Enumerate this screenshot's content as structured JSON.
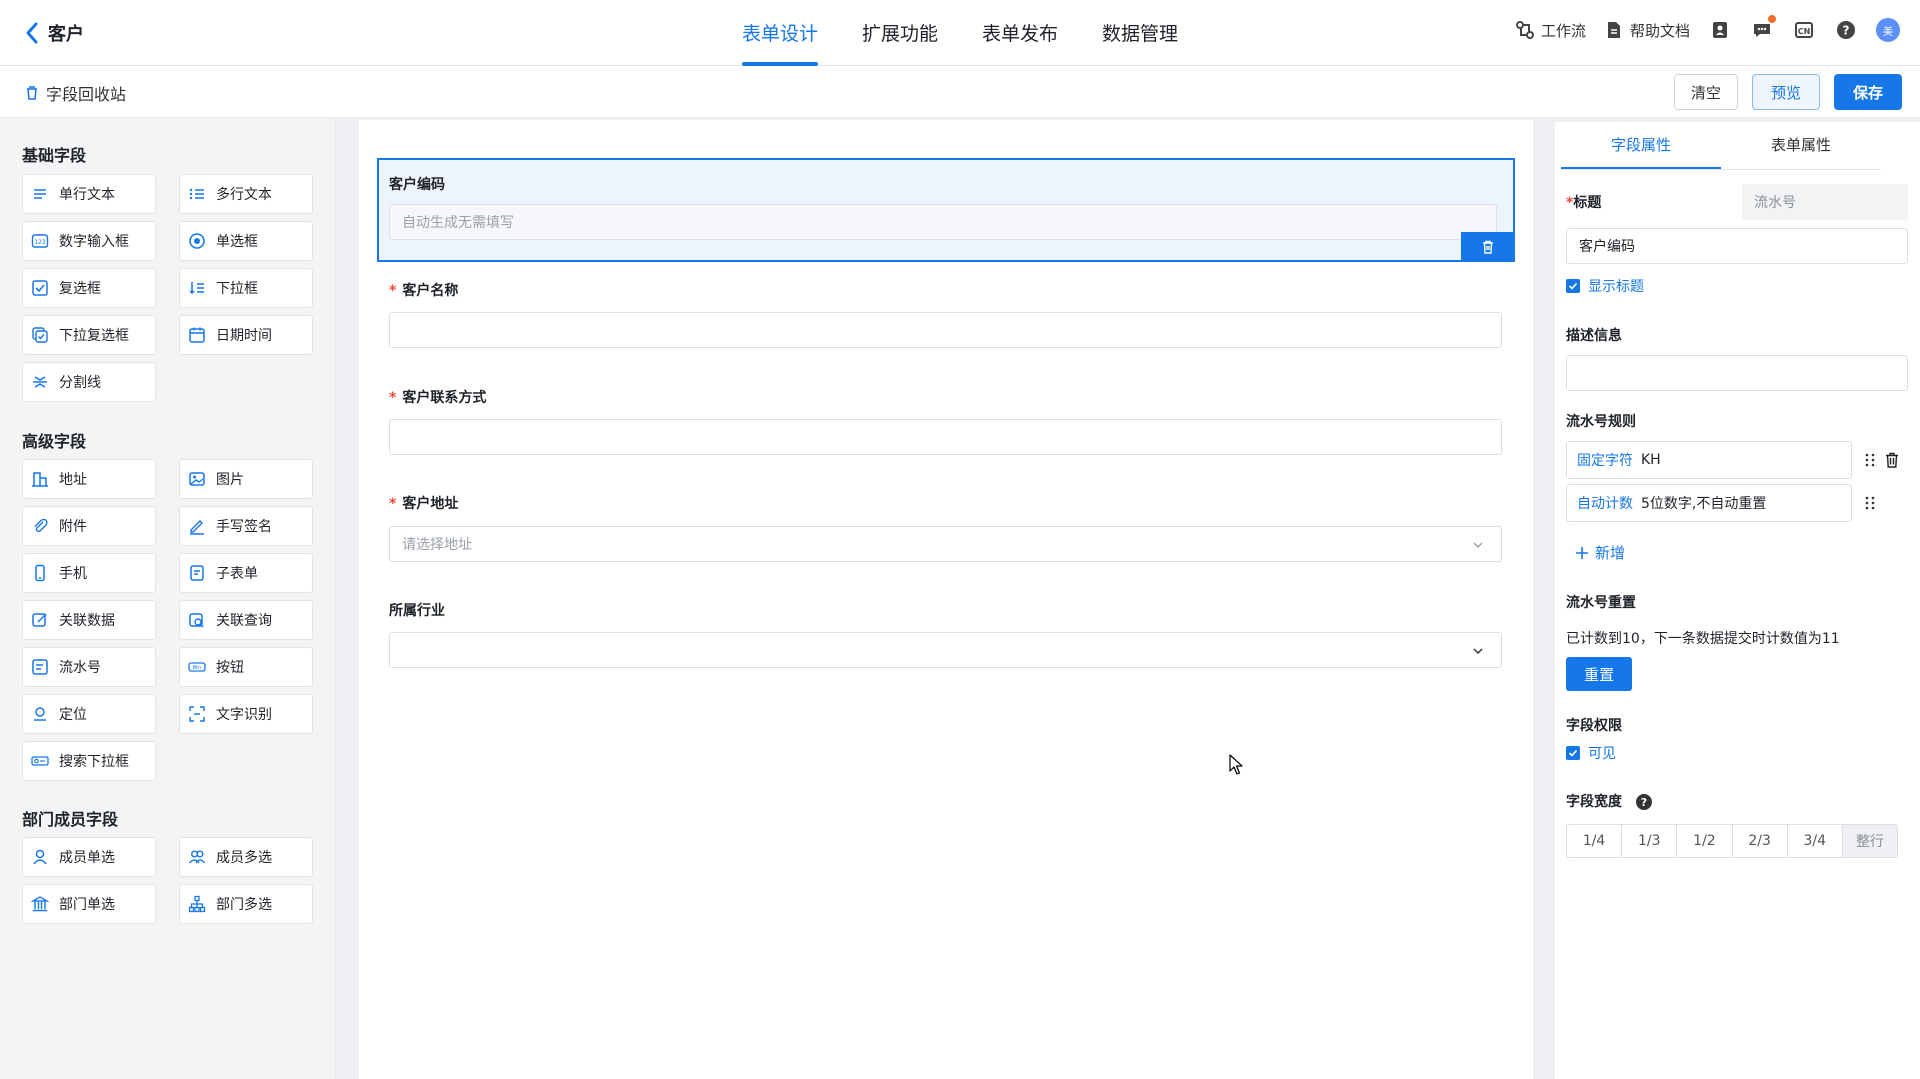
{
  "header": {
    "back_label": "客户",
    "tabs": [
      {
        "label": "表单设计",
        "active": true
      },
      {
        "label": "扩展功能",
        "active": false
      },
      {
        "label": "表单发布",
        "active": false
      },
      {
        "label": "数据管理",
        "active": false
      }
    ],
    "tools": {
      "workflow": "工作流",
      "help_docs": "帮助文档"
    },
    "avatar_text": "美"
  },
  "subbar": {
    "recycle": "字段回收站",
    "clear": "清空",
    "preview": "预览",
    "save": "保存"
  },
  "sidebar": {
    "groups": [
      {
        "title": "基础字段",
        "items": [
          "单行文本",
          "多行文本",
          "数字输入框",
          "单选框",
          "复选框",
          "下拉框",
          "下拉复选框",
          "日期时间",
          "分割线"
        ]
      },
      {
        "title": "高级字段",
        "items": [
          "地址",
          "图片",
          "附件",
          "手写签名",
          "手机",
          "子表单",
          "关联数据",
          "关联查询",
          "流水号",
          "按钮",
          "定位",
          "文字识别",
          "搜索下拉框"
        ]
      },
      {
        "title": "部门成员字段",
        "items": [
          "成员单选",
          "成员多选",
          "部门单选",
          "部门多选"
        ]
      }
    ]
  },
  "form": {
    "fields": [
      {
        "label": "客户编码",
        "required": false,
        "placeholder": "自动生成无需填写"
      },
      {
        "label": "客户名称",
        "required": true,
        "placeholder": ""
      },
      {
        "label": "客户联系方式",
        "required": true,
        "placeholder": ""
      },
      {
        "label": "客户地址",
        "required": true,
        "placeholder": "请选择地址"
      },
      {
        "label": "所属行业",
        "required": false,
        "placeholder": ""
      }
    ]
  },
  "props": {
    "tabs": [
      "字段属性",
      "表单属性"
    ],
    "title_label": "标题",
    "type_tag": "流水号",
    "title_value": "客户编码",
    "show_title": "显示标题",
    "desc_label": "描述信息",
    "rule_label": "流水号规则",
    "rules": [
      {
        "key": "固定字符",
        "value": "KH"
      },
      {
        "key": "自动计数",
        "value": "5位数字,不自动重置"
      }
    ],
    "add_label": "新增",
    "reset_label": "流水号重置",
    "reset_text": "已计数到10，下一条数据提交时计数值为11",
    "reset_button": "重置",
    "perm_label": "字段权限",
    "perm_visible": "可见",
    "width_label": "字段宽度",
    "width_options": [
      "1/4",
      "1/3",
      "1/2",
      "2/3",
      "3/4",
      "整行"
    ],
    "accent_color": "#1677e8"
  }
}
